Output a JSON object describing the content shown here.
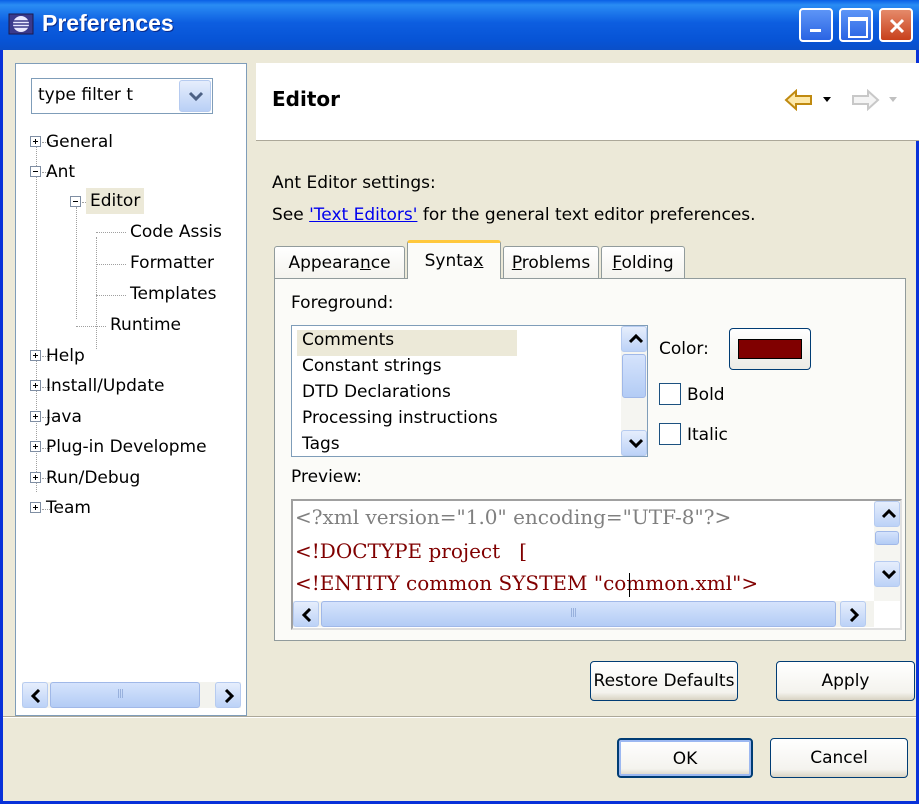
{
  "window": {
    "title": "Preferences",
    "icon": "eclipse-icon",
    "controls": [
      "minimize",
      "maximize",
      "close"
    ]
  },
  "filter": {
    "value": "type filter t"
  },
  "tree": [
    {
      "label": "General",
      "expander": "plus"
    },
    {
      "label": "Ant",
      "expander": "minus"
    },
    {
      "label": "Editor",
      "expander": "minus",
      "selected": true
    },
    {
      "label": "Code Assis"
    },
    {
      "label": "Formatter"
    },
    {
      "label": "Templates"
    },
    {
      "label": "Runtime"
    },
    {
      "label": "Help",
      "expander": "plus"
    },
    {
      "label": "Install/Update",
      "expander": "plus"
    },
    {
      "label": "Java",
      "expander": "plus"
    },
    {
      "label": "Plug-in Developme",
      "expander": "plus"
    },
    {
      "label": "Run/Debug",
      "expander": "plus"
    },
    {
      "label": "Team",
      "expander": "plus"
    }
  ],
  "page": {
    "title": "Editor",
    "settings_text": "Ant Editor settings:",
    "see_prefix": "See ",
    "see_link": "'Text Editors'",
    "see_suffix": " for the general text editor preferences."
  },
  "tabs": [
    {
      "label": "Appearance",
      "mnemonic": "n"
    },
    {
      "label": "Syntax",
      "mnemonic": "x",
      "active": true
    },
    {
      "label": "Problems",
      "mnemonic": "P"
    },
    {
      "label": "Folding",
      "mnemonic": "F"
    }
  ],
  "syntax": {
    "foreground_label": "Foreground:",
    "items": [
      "Comments",
      "Constant strings",
      "DTD Declarations",
      "Processing instructions",
      "Tags"
    ],
    "selected_item": "Comments",
    "color_label": "Color:",
    "color_value": "#800000",
    "bold_label": "Bold",
    "bold_checked": false,
    "italic_label": "Italic",
    "italic_checked": false,
    "preview_label": "Preview:",
    "preview_lines": [
      {
        "text": "<?xml version=\"1.0\" encoding=\"UTF-8\"?>",
        "color": "#808080"
      },
      {
        "text": "<!DOCTYPE project   [",
        "color": "#800000"
      },
      {
        "text": "<!ENTITY common SYSTEM \"common.xml\">",
        "color": "#800000"
      }
    ]
  },
  "buttons": {
    "restore_defaults": "Restore Defaults",
    "apply": "Apply",
    "ok": "OK",
    "cancel": "Cancel"
  },
  "colors": {
    "titlebar": "#0754d6",
    "dialog_bg": "#ece9d8",
    "link": "#0000ee",
    "active_tab_accent": "#ffc83c"
  }
}
